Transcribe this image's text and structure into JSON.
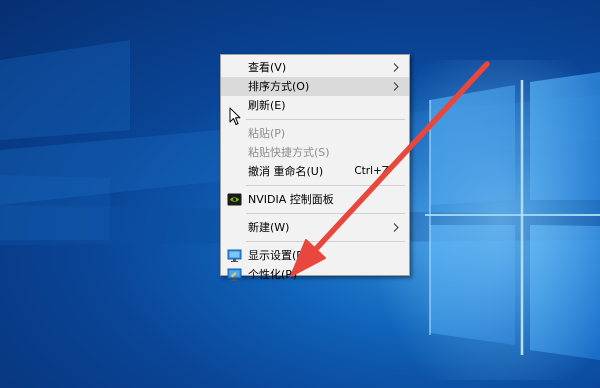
{
  "context_menu": {
    "items": [
      {
        "label": "查看(V)",
        "has_submenu": true
      },
      {
        "label": "排序方式(O)",
        "has_submenu": true,
        "highlighted": true
      },
      {
        "label": "刷新(E)"
      },
      {
        "label": "粘贴(P)",
        "disabled": true
      },
      {
        "label": "粘贴快捷方式(S)",
        "disabled": true
      },
      {
        "label": "撤消 重命名(U)",
        "shortcut": "Ctrl+Z"
      },
      {
        "label": "NVIDIA 控制面板",
        "icon": "nvidia-icon"
      },
      {
        "label": "新建(W)",
        "has_submenu": true
      },
      {
        "label": "显示设置(D)",
        "icon": "display-settings-icon"
      },
      {
        "label": "个性化(R)",
        "icon": "personalize-icon"
      }
    ]
  },
  "colors": {
    "annotation_arrow": "#e8473d",
    "menu_background": "#f2f2f2",
    "menu_highlight": "#dadada",
    "disabled_text": "#8d8d8d",
    "nvidia_green": "#76b900",
    "desktop_blue": "#0a4597"
  }
}
